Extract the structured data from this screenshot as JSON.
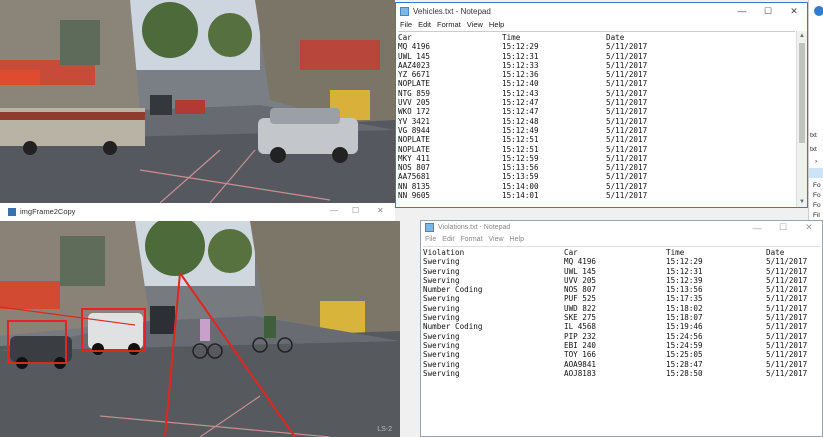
{
  "top_feed": {
    "label": ""
  },
  "bottom_feed": {
    "label": "LS-2"
  },
  "imgframe": {
    "title": "imgFrame2Copy",
    "min": "—",
    "max": "☐",
    "close": "✕"
  },
  "vehicles": {
    "title": "Vehicles.txt - Notepad",
    "menu": [
      "File",
      "Edit",
      "Format",
      "View",
      "Help"
    ],
    "headers": [
      "Car",
      "Time",
      "Date"
    ],
    "rows": [
      [
        "MQ 4196",
        "15:12:29",
        "5/11/2017"
      ],
      [
        "UWL 145",
        "15:12:31",
        "5/11/2017"
      ],
      [
        "AAZ4023",
        "15:12:33",
        "5/11/2017"
      ],
      [
        "YZ 6671",
        "15:12:36",
        "5/11/2017"
      ],
      [
        "NOPLATE",
        "15:12:40",
        "5/11/2017"
      ],
      [
        "NTG 859",
        "15:12:43",
        "5/11/2017"
      ],
      [
        "UVV 205",
        "15:12:47",
        "5/11/2017"
      ],
      [
        "WKO 172",
        "15:12:47",
        "5/11/2017"
      ],
      [
        "YV 3421",
        "15:12:48",
        "5/11/2017"
      ],
      [
        "VG 8944",
        "15:12:49",
        "5/11/2017"
      ],
      [
        "NOPLATE",
        "15:12:51",
        "5/11/2017"
      ],
      [
        "NOPLATE",
        "15:12:51",
        "5/11/2017"
      ],
      [
        "MKY 411",
        "15:12:59",
        "5/11/2017"
      ],
      [
        "NOS 807",
        "15:13:56",
        "5/11/2017"
      ],
      [
        "AA75681",
        "15:13:59",
        "5/11/2017"
      ],
      [
        "NN 8135",
        "15:14:00",
        "5/11/2017"
      ],
      [
        "NN 9605",
        "15:14:01",
        "5/11/2017"
      ]
    ]
  },
  "violations": {
    "title": "Violations.txt - Notepad",
    "menu": [
      "File",
      "Edit",
      "Format",
      "View",
      "Help"
    ],
    "headers": [
      "Violation",
      "Car",
      "Time",
      "Date"
    ],
    "rows": [
      [
        "Swerving",
        "MQ 4196",
        "15:12:29",
        "5/11/2017"
      ],
      [
        "Swerving",
        "UWL 145",
        "15:12:31",
        "5/11/2017"
      ],
      [
        "Swerving",
        "UVV 205",
        "15:12:39",
        "5/11/2017"
      ],
      [
        "Number Coding",
        "NOS 807",
        "15:13:56",
        "5/11/2017"
      ],
      [
        "Swerving",
        "PUF 525",
        "15:17:35",
        "5/11/2017"
      ],
      [
        "Swerving",
        "UWD 822",
        "15:18:02",
        "5/11/2017"
      ],
      [
        "Swerving",
        "SKE 275",
        "15:18:07",
        "5/11/2017"
      ],
      [
        "Number Coding",
        "IL 4568",
        "15:19:46",
        "5/11/2017"
      ],
      [
        "Swerving",
        "PIP 232",
        "15:24:56",
        "5/11/2017"
      ],
      [
        "Swerving",
        "EBI 240",
        "15:24:59",
        "5/11/2017"
      ],
      [
        "Swerving",
        "TOY 166",
        "15:25:05",
        "5/11/2017"
      ],
      [
        "Swerving",
        "AOA9841",
        "15:28:47",
        "5/11/2017"
      ],
      [
        "Swerving",
        "AOJ8183",
        "15:28:50",
        "5/11/2017"
      ]
    ]
  },
  "side": {
    "items": [
      "txt",
      "txt",
      "Fo",
      "Fo",
      "Fo",
      "Fil"
    ]
  },
  "colors": {
    "detect_red": "#e0261e",
    "accent": "#2d7dd2"
  }
}
